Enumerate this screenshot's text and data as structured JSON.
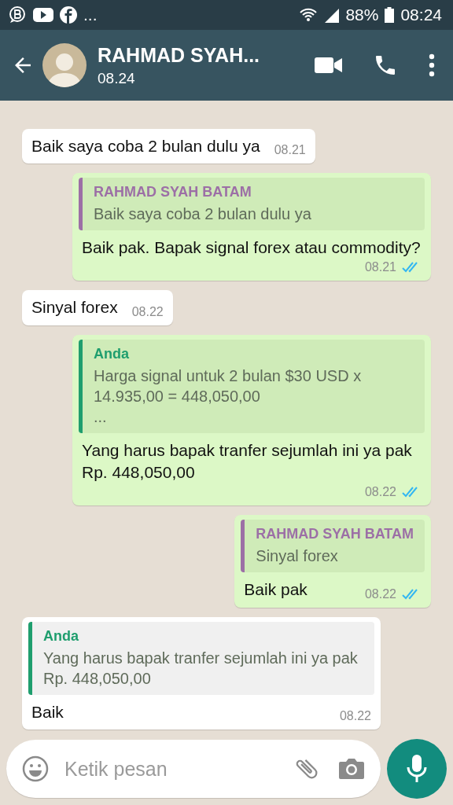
{
  "status_bar": {
    "more": "...",
    "battery": "88%",
    "time": "08:24"
  },
  "header": {
    "name": "RAHMAD SYAH...",
    "last_seen": "08.24"
  },
  "messages": [
    {
      "kind": "incoming",
      "text": "Baik saya coba 2 bulan dulu ya",
      "time": "08.21"
    },
    {
      "kind": "outgoing",
      "quote": {
        "author": "RAHMAD SYAH BATAM",
        "color": "#9c6fa6",
        "text": "Baik saya coba 2 bulan dulu ya"
      },
      "text": "Baik pak. Bapak signal forex atau commodity?",
      "time": "08.21",
      "read": true
    },
    {
      "kind": "incoming",
      "text": "Sinyal forex",
      "time": "08.22"
    },
    {
      "kind": "outgoing",
      "quote": {
        "author": "Anda",
        "color": "#1f9e6e",
        "text": "Harga signal untuk 2 bulan $30 USD x 14.935,00 = 448,050,00\n..."
      },
      "text": "Yang harus bapak tranfer sejumlah ini ya pak Rp. 448,050,00",
      "time": "08.22",
      "read": true
    },
    {
      "kind": "outgoing",
      "quote": {
        "author": "RAHMAD SYAH BATAM",
        "color": "#9c6fa6",
        "text": "Sinyal forex"
      },
      "text": "Baik pak",
      "time": "08.22",
      "read": true
    },
    {
      "kind": "incoming",
      "quote": {
        "author": "Anda",
        "color": "#1f9e6e",
        "text": "Yang harus bapak tranfer sejumlah ini ya pak Rp. 448,050,00"
      },
      "text": "Baik",
      "time": "08.22"
    }
  ],
  "composer": {
    "placeholder": "Ketik pesan"
  }
}
